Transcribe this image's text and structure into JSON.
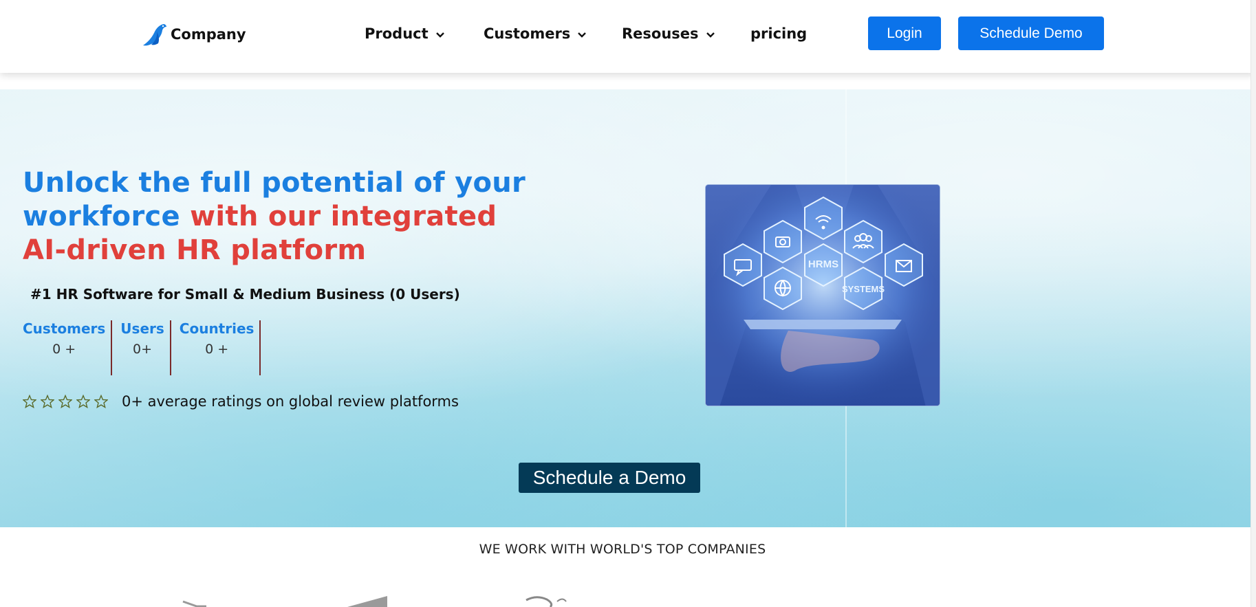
{
  "header": {
    "logo_text": "Company",
    "logo_icon": "bird-logo-icon",
    "nav": [
      {
        "label": "Product",
        "has_dropdown": true
      },
      {
        "label": "Customers",
        "has_dropdown": true
      },
      {
        "label": "Resouses",
        "has_dropdown": true
      },
      {
        "label": "pricing",
        "has_dropdown": false
      }
    ],
    "login_label": "Login",
    "schedule_demo_label": "Schedule Demo"
  },
  "hero": {
    "headline_blue": "Unlock the full potential of your workforce",
    "headline_red": "with our integrated AI-driven HR platform",
    "subheadline": "#1 HR Software for Small & Medium Business (0 Users)",
    "stats": [
      {
        "label": "Customers",
        "value": "0 +"
      },
      {
        "label": "Users",
        "value": "0+"
      },
      {
        "label": "Countries",
        "value": "0 +"
      }
    ],
    "rating_stars": 5,
    "rating_filled": 0,
    "ratings_text": "0+ average ratings on global review platforms",
    "image": {
      "description_icon": "hrms-hexagon-network-icon",
      "hex_labels": [
        "HRMS",
        "SYSTEMS"
      ]
    },
    "cta_label": "Schedule a Demo"
  },
  "companies": {
    "title": "WE WORK WITH WORLD'S TOP COMPANIES"
  },
  "colors": {
    "primary_blue": "#0b73ea",
    "headline_blue": "#1b7fe0",
    "headline_red": "#e0403b",
    "cta_navy": "#043a56",
    "stat_divider": "#7a2a2a",
    "star_outline": "#5a6a2a"
  }
}
